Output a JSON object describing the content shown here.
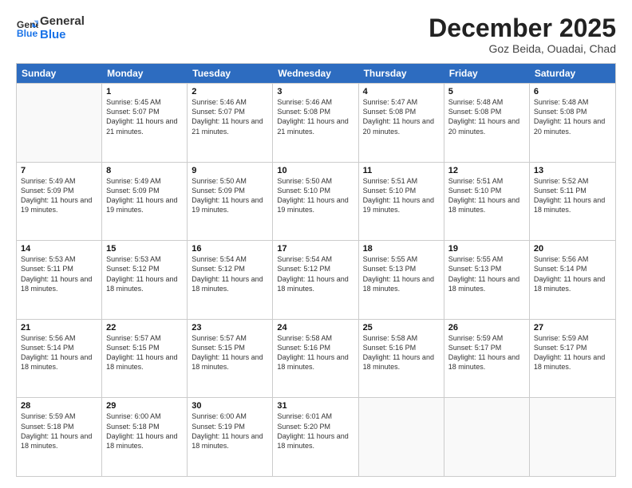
{
  "header": {
    "logo_line1": "General",
    "logo_line2": "Blue",
    "month": "December 2025",
    "location": "Goz Beida, Ouadai, Chad"
  },
  "weekdays": [
    "Sunday",
    "Monday",
    "Tuesday",
    "Wednesday",
    "Thursday",
    "Friday",
    "Saturday"
  ],
  "weeks": [
    [
      {
        "day": "",
        "sunrise": "",
        "sunset": "",
        "daylight": ""
      },
      {
        "day": "1",
        "sunrise": "Sunrise: 5:45 AM",
        "sunset": "Sunset: 5:07 PM",
        "daylight": "Daylight: 11 hours and 21 minutes."
      },
      {
        "day": "2",
        "sunrise": "Sunrise: 5:46 AM",
        "sunset": "Sunset: 5:07 PM",
        "daylight": "Daylight: 11 hours and 21 minutes."
      },
      {
        "day": "3",
        "sunrise": "Sunrise: 5:46 AM",
        "sunset": "Sunset: 5:08 PM",
        "daylight": "Daylight: 11 hours and 21 minutes."
      },
      {
        "day": "4",
        "sunrise": "Sunrise: 5:47 AM",
        "sunset": "Sunset: 5:08 PM",
        "daylight": "Daylight: 11 hours and 20 minutes."
      },
      {
        "day": "5",
        "sunrise": "Sunrise: 5:48 AM",
        "sunset": "Sunset: 5:08 PM",
        "daylight": "Daylight: 11 hours and 20 minutes."
      },
      {
        "day": "6",
        "sunrise": "Sunrise: 5:48 AM",
        "sunset": "Sunset: 5:08 PM",
        "daylight": "Daylight: 11 hours and 20 minutes."
      }
    ],
    [
      {
        "day": "7",
        "sunrise": "Sunrise: 5:49 AM",
        "sunset": "Sunset: 5:09 PM",
        "daylight": "Daylight: 11 hours and 19 minutes."
      },
      {
        "day": "8",
        "sunrise": "Sunrise: 5:49 AM",
        "sunset": "Sunset: 5:09 PM",
        "daylight": "Daylight: 11 hours and 19 minutes."
      },
      {
        "day": "9",
        "sunrise": "Sunrise: 5:50 AM",
        "sunset": "Sunset: 5:09 PM",
        "daylight": "Daylight: 11 hours and 19 minutes."
      },
      {
        "day": "10",
        "sunrise": "Sunrise: 5:50 AM",
        "sunset": "Sunset: 5:10 PM",
        "daylight": "Daylight: 11 hours and 19 minutes."
      },
      {
        "day": "11",
        "sunrise": "Sunrise: 5:51 AM",
        "sunset": "Sunset: 5:10 PM",
        "daylight": "Daylight: 11 hours and 19 minutes."
      },
      {
        "day": "12",
        "sunrise": "Sunrise: 5:51 AM",
        "sunset": "Sunset: 5:10 PM",
        "daylight": "Daylight: 11 hours and 18 minutes."
      },
      {
        "day": "13",
        "sunrise": "Sunrise: 5:52 AM",
        "sunset": "Sunset: 5:11 PM",
        "daylight": "Daylight: 11 hours and 18 minutes."
      }
    ],
    [
      {
        "day": "14",
        "sunrise": "Sunrise: 5:53 AM",
        "sunset": "Sunset: 5:11 PM",
        "daylight": "Daylight: 11 hours and 18 minutes."
      },
      {
        "day": "15",
        "sunrise": "Sunrise: 5:53 AM",
        "sunset": "Sunset: 5:12 PM",
        "daylight": "Daylight: 11 hours and 18 minutes."
      },
      {
        "day": "16",
        "sunrise": "Sunrise: 5:54 AM",
        "sunset": "Sunset: 5:12 PM",
        "daylight": "Daylight: 11 hours and 18 minutes."
      },
      {
        "day": "17",
        "sunrise": "Sunrise: 5:54 AM",
        "sunset": "Sunset: 5:12 PM",
        "daylight": "Daylight: 11 hours and 18 minutes."
      },
      {
        "day": "18",
        "sunrise": "Sunrise: 5:55 AM",
        "sunset": "Sunset: 5:13 PM",
        "daylight": "Daylight: 11 hours and 18 minutes."
      },
      {
        "day": "19",
        "sunrise": "Sunrise: 5:55 AM",
        "sunset": "Sunset: 5:13 PM",
        "daylight": "Daylight: 11 hours and 18 minutes."
      },
      {
        "day": "20",
        "sunrise": "Sunrise: 5:56 AM",
        "sunset": "Sunset: 5:14 PM",
        "daylight": "Daylight: 11 hours and 18 minutes."
      }
    ],
    [
      {
        "day": "21",
        "sunrise": "Sunrise: 5:56 AM",
        "sunset": "Sunset: 5:14 PM",
        "daylight": "Daylight: 11 hours and 18 minutes."
      },
      {
        "day": "22",
        "sunrise": "Sunrise: 5:57 AM",
        "sunset": "Sunset: 5:15 PM",
        "daylight": "Daylight: 11 hours and 18 minutes."
      },
      {
        "day": "23",
        "sunrise": "Sunrise: 5:57 AM",
        "sunset": "Sunset: 5:15 PM",
        "daylight": "Daylight: 11 hours and 18 minutes."
      },
      {
        "day": "24",
        "sunrise": "Sunrise: 5:58 AM",
        "sunset": "Sunset: 5:16 PM",
        "daylight": "Daylight: 11 hours and 18 minutes."
      },
      {
        "day": "25",
        "sunrise": "Sunrise: 5:58 AM",
        "sunset": "Sunset: 5:16 PM",
        "daylight": "Daylight: 11 hours and 18 minutes."
      },
      {
        "day": "26",
        "sunrise": "Sunrise: 5:59 AM",
        "sunset": "Sunset: 5:17 PM",
        "daylight": "Daylight: 11 hours and 18 minutes."
      },
      {
        "day": "27",
        "sunrise": "Sunrise: 5:59 AM",
        "sunset": "Sunset: 5:17 PM",
        "daylight": "Daylight: 11 hours and 18 minutes."
      }
    ],
    [
      {
        "day": "28",
        "sunrise": "Sunrise: 5:59 AM",
        "sunset": "Sunset: 5:18 PM",
        "daylight": "Daylight: 11 hours and 18 minutes."
      },
      {
        "day": "29",
        "sunrise": "Sunrise: 6:00 AM",
        "sunset": "Sunset: 5:18 PM",
        "daylight": "Daylight: 11 hours and 18 minutes."
      },
      {
        "day": "30",
        "sunrise": "Sunrise: 6:00 AM",
        "sunset": "Sunset: 5:19 PM",
        "daylight": "Daylight: 11 hours and 18 minutes."
      },
      {
        "day": "31",
        "sunrise": "Sunrise: 6:01 AM",
        "sunset": "Sunset: 5:20 PM",
        "daylight": "Daylight: 11 hours and 18 minutes."
      },
      {
        "day": "",
        "sunrise": "",
        "sunset": "",
        "daylight": ""
      },
      {
        "day": "",
        "sunrise": "",
        "sunset": "",
        "daylight": ""
      },
      {
        "day": "",
        "sunrise": "",
        "sunset": "",
        "daylight": ""
      }
    ]
  ]
}
